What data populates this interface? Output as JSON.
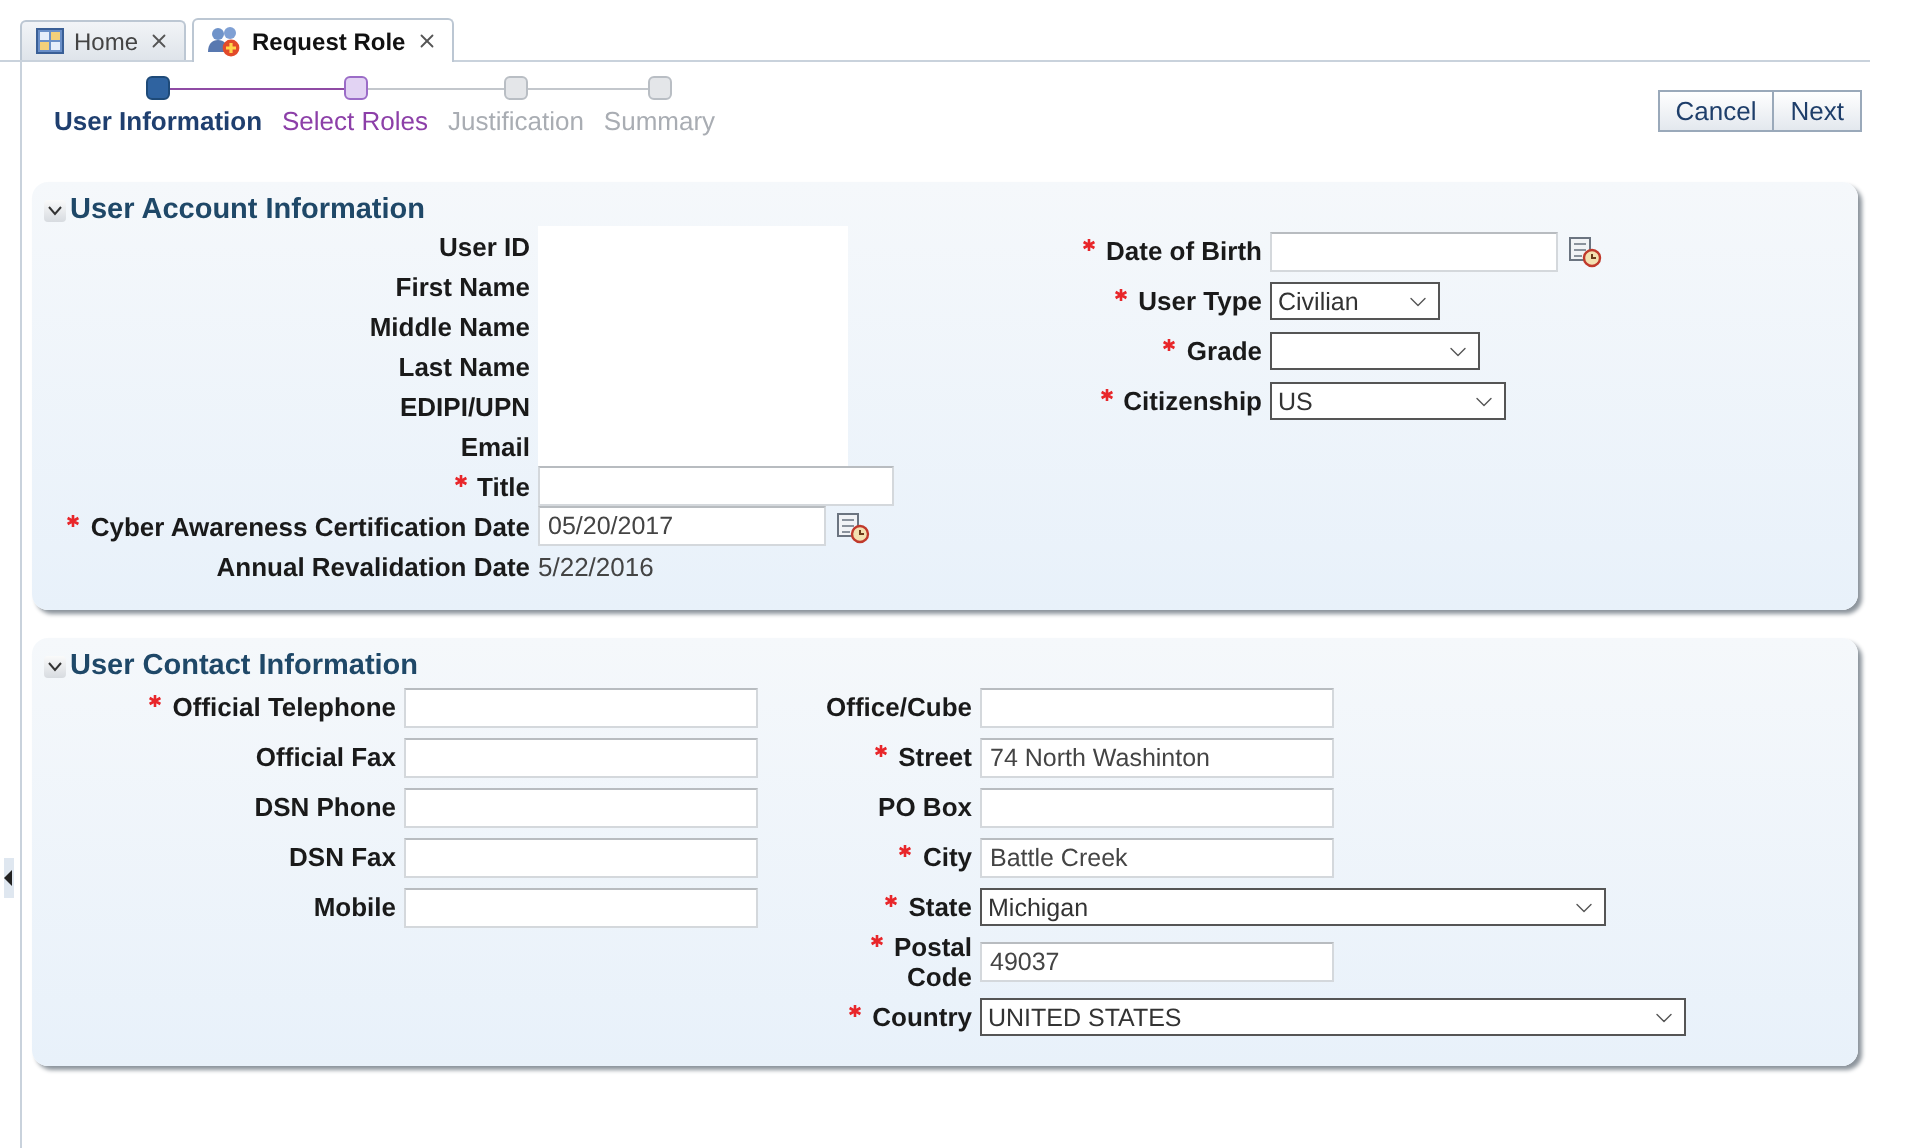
{
  "tabs": [
    {
      "label": "Home",
      "kind": "home",
      "selected": false
    },
    {
      "label": "Request Role",
      "kind": "roles",
      "selected": true
    }
  ],
  "steps": [
    {
      "label": "User Information",
      "selected": true,
      "disabled": false
    },
    {
      "label": "Select Roles",
      "selected": false,
      "disabled": false
    },
    {
      "label": "Justification",
      "selected": false,
      "disabled": true
    },
    {
      "label": "Summary",
      "selected": false,
      "disabled": true
    }
  ],
  "buttons": [
    "Cancel",
    "Next"
  ],
  "sections": [
    {
      "title": "User Account Information",
      "expanded": true,
      "columns": [
        [
          {
            "label": "User ID",
            "required": false,
            "kind": "blank"
          },
          {
            "label": "First Name",
            "required": false,
            "kind": "blank"
          },
          {
            "label": "Middle Name",
            "required": false,
            "kind": "blank"
          },
          {
            "label": "Last Name",
            "required": false,
            "kind": "blank"
          },
          {
            "label": "EDIPI/UPN",
            "required": false,
            "kind": "blank"
          },
          {
            "label": "Email",
            "required": false,
            "kind": "blank"
          },
          {
            "label": "Title",
            "required": true,
            "kind": "text"
          },
          {
            "label": "Cyber Awareness Certification Date",
            "required": true,
            "kind": "date",
            "value": "05/20/2017"
          },
          {
            "label": "Annual Revalidation Date",
            "required": false,
            "kind": "display",
            "value": "5/22/2016"
          }
        ],
        [
          {
            "label": "Date of Birth",
            "required": true,
            "kind": "date"
          },
          {
            "label": "User Type",
            "required": true,
            "kind": "select",
            "value": "Civilian"
          },
          {
            "label": "Grade",
            "required": true,
            "kind": "select"
          },
          {
            "label": "Citizenship",
            "required": true,
            "kind": "select",
            "value": "US"
          }
        ]
      ]
    },
    {
      "title": "User Contact Information",
      "expanded": true,
      "columns": [
        [
          {
            "label": "Official Telephone",
            "required": true,
            "kind": "text"
          },
          {
            "label": "Official Fax",
            "required": false,
            "kind": "text"
          },
          {
            "label": "DSN Phone",
            "required": false,
            "kind": "text"
          },
          {
            "label": "DSN Fax",
            "required": false,
            "kind": "text"
          },
          {
            "label": "Mobile",
            "required": false,
            "kind": "text"
          }
        ],
        [
          {
            "label": "Office/Cube",
            "required": false,
            "kind": "text"
          },
          {
            "label": "Street",
            "required": true,
            "kind": "text",
            "value": "74 North Washinton"
          },
          {
            "label": "PO Box",
            "required": false,
            "kind": "text"
          },
          {
            "label": "City",
            "required": true,
            "kind": "text",
            "value": "Battle Creek"
          },
          {
            "label": "State",
            "required": true,
            "kind": "select",
            "value": "Michigan"
          },
          {
            "label": "Postal Code",
            "required": true,
            "kind": "text",
            "value": "49037"
          },
          {
            "label": "Country",
            "required": true,
            "kind": "select",
            "value": "UNITED STATES"
          }
        ]
      ]
    }
  ]
}
